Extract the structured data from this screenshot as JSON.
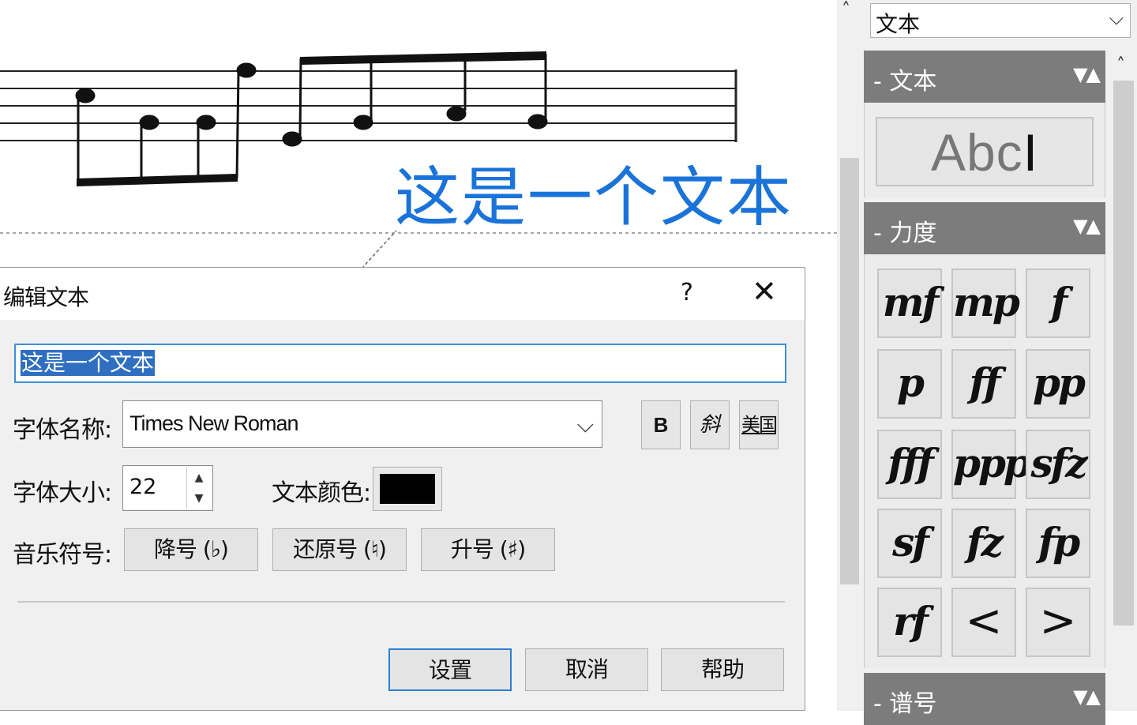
{
  "score": {
    "sample_text": "这是一个文本"
  },
  "dialog": {
    "title": "编辑文本",
    "help_glyph": "?",
    "close_glyph": "✕",
    "text_value": "这是一个文本",
    "font_name_label": "字体名称:",
    "font_name_value": "Times New Roman",
    "bold_label": "B",
    "italic_label": "斜",
    "underline_label": "美国",
    "font_size_label": "字体大小:",
    "font_size_value": "22",
    "text_color_label": "文本颜色:",
    "text_color": "#000000",
    "music_symbol_label": "音乐符号:",
    "flat_label": "降号 (♭)",
    "natural_label": "还原号 (♮)",
    "sharp_label": "升号 (♯)",
    "ok_label": "设置",
    "cancel_label": "取消",
    "help_label": "帮助"
  },
  "palette": {
    "selector_value": "文本",
    "sections": {
      "text": {
        "title": "- 文本",
        "controls": "▼▲"
      },
      "dynamics": {
        "title": "- 力度",
        "controls": "▼▲"
      },
      "clef": {
        "title": "- 谱号",
        "controls": "▼▲"
      }
    },
    "abc_text": "Abc",
    "abc_cursor": "I",
    "dynamics": [
      "mf",
      "mp",
      "f",
      "p",
      "ff",
      "pp",
      "fff",
      "ppp",
      "sfz",
      "sf",
      "fz",
      "fp",
      "rf",
      "<",
      ">"
    ]
  },
  "icons": {
    "scroll_up": "scroll-up-icon",
    "chevron": "chevron-down-icon"
  },
  "colors": {
    "score_text": "#1a73d9",
    "selection": "#2e6fc2",
    "focus_border": "#2c7fd2",
    "section_header": "#7c7c7c"
  }
}
